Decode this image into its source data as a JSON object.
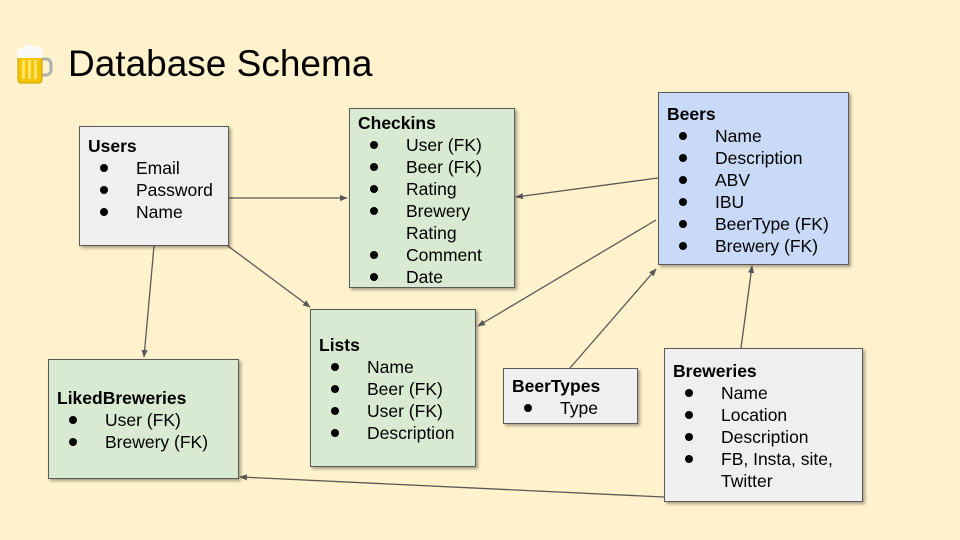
{
  "slide": {
    "title": "Database Schema",
    "title_icon": "beer-mug-icon",
    "colors": {
      "background": "#fff2cc",
      "green_box": "#d9ead3",
      "grey_box": "#efefef",
      "blue_box": "#c9daf8",
      "connector": "#595959"
    }
  },
  "tables": {
    "users": {
      "name": "Users",
      "fields": [
        "Email",
        "Password",
        "Name"
      ]
    },
    "checkins": {
      "name": "Checkins",
      "fields": [
        "User (FK)",
        "Beer (FK)",
        "Rating",
        "Brewery",
        "Rating",
        "Comment",
        "Date"
      ]
    },
    "beers": {
      "name": "Beers",
      "fields": [
        "Name",
        "Description",
        "ABV",
        "IBU",
        "BeerType (FK)",
        "Brewery (FK)"
      ]
    },
    "lists": {
      "name": "Lists",
      "fields": [
        "Name",
        "Beer (FK)",
        "User (FK)",
        "Description"
      ]
    },
    "beertypes": {
      "name": "BeerTypes",
      "fields": [
        "Type"
      ]
    },
    "liked_breweries": {
      "name": "LikedBreweries",
      "fields": [
        "User (FK)",
        "Brewery (FK)"
      ]
    },
    "breweries": {
      "name": "Breweries",
      "fields": [
        "Name",
        "Location",
        "Description",
        "FB, Insta, site,",
        "Twitter"
      ]
    }
  },
  "relationships": [
    {
      "from": "Users",
      "to": "Checkins"
    },
    {
      "from": "Users",
      "to": "Lists"
    },
    {
      "from": "Users",
      "to": "LikedBreweries"
    },
    {
      "from": "Beers",
      "to": "Checkins"
    },
    {
      "from": "Beers",
      "to": "Lists"
    },
    {
      "from": "BeerTypes",
      "to": "Beers"
    },
    {
      "from": "Breweries",
      "to": "Beers"
    },
    {
      "from": "Breweries",
      "to": "LikedBreweries"
    }
  ]
}
